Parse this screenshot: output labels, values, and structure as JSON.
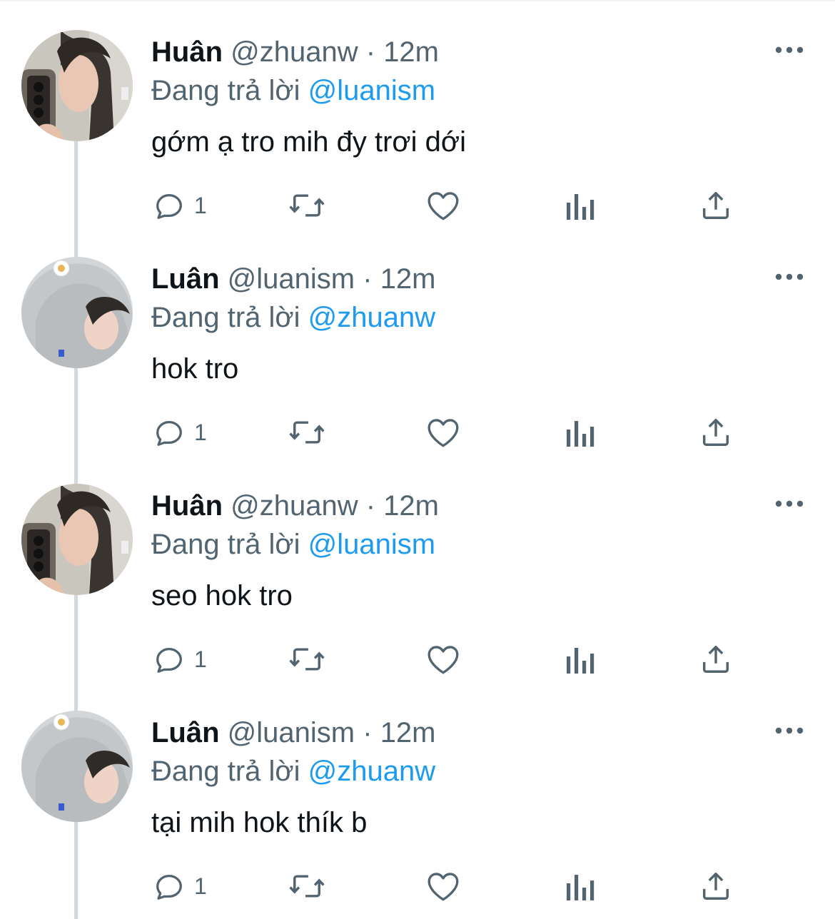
{
  "colors": {
    "text_primary": "#0f1419",
    "text_secondary": "#536471",
    "accent": "#1d9bf0",
    "thread_line": "#cfd9de"
  },
  "icons": {
    "reply": "reply-bubble-icon",
    "retweet": "retweet-arrows-icon",
    "like": "heart-icon",
    "views": "bar-chart-icon",
    "share": "share-upload-icon",
    "more": "more-dots-icon"
  },
  "tweets": [
    {
      "name": "Huân",
      "handle": "@zhuanw",
      "sep": "·",
      "time": "12m",
      "replying_prefix": "Đang trả lời",
      "replying_to": "@luanism",
      "text": "gớm ạ tro mih đy trơi dới",
      "reply_count": "1"
    },
    {
      "name": "Luân",
      "handle": "@luanism",
      "sep": "·",
      "time": "12m",
      "replying_prefix": "Đang trả lời",
      "replying_to": "@zhuanw",
      "text": "hok tro",
      "reply_count": "1"
    },
    {
      "name": "Huân",
      "handle": "@zhuanw",
      "sep": "·",
      "time": "12m",
      "replying_prefix": "Đang trả lời",
      "replying_to": "@luanism",
      "text": "seo hok tro",
      "reply_count": "1"
    },
    {
      "name": "Luân",
      "handle": "@luanism",
      "sep": "·",
      "time": "12m",
      "replying_prefix": "Đang trả lời",
      "replying_to": "@zhuanw",
      "text": "tại mih hok thík b",
      "reply_count": "1"
    }
  ]
}
